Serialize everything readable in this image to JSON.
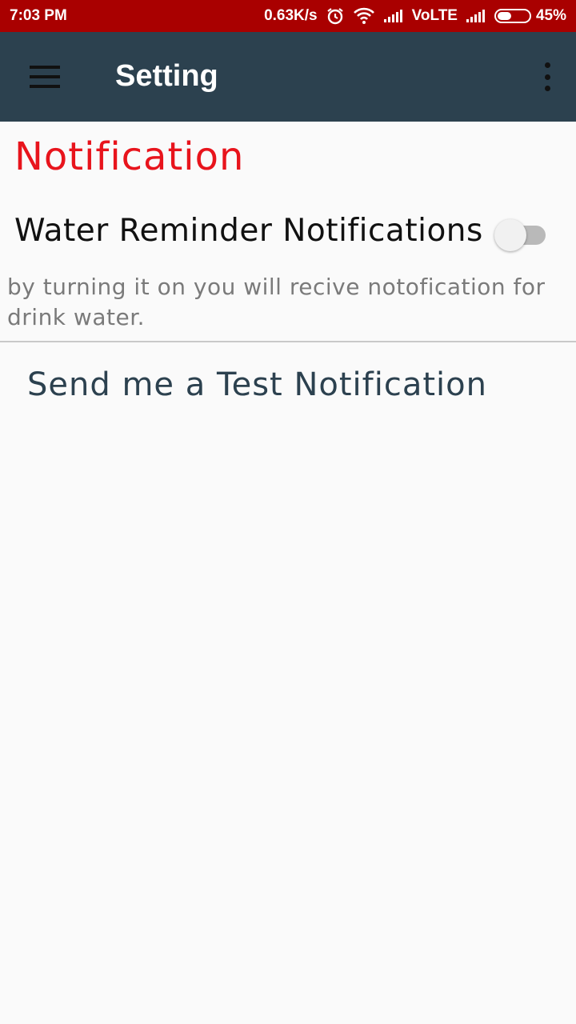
{
  "status_bar": {
    "time": "7:03 PM",
    "net_speed": "0.63K/s",
    "network_type": "VoLTE",
    "battery_percent": "45%",
    "battery_level": 0.45,
    "icons": [
      "alarm-icon",
      "wifi-icon",
      "signal-icon",
      "signal-icon",
      "battery-icon"
    ],
    "color": "#a90000"
  },
  "app_bar": {
    "title": "Setting",
    "color": "#2c414f",
    "menu_icon": "hamburger-menu-icon",
    "overflow_icon": "more-vert-icon"
  },
  "notification_section": {
    "title": "Notification",
    "title_color": "#e8141c",
    "water_reminder": {
      "label": "Water Reminder Notifications",
      "enabled": false,
      "description": "by turning it on you will recive notofication for drink water."
    },
    "test_button_label": "Send me a Test Notification"
  }
}
